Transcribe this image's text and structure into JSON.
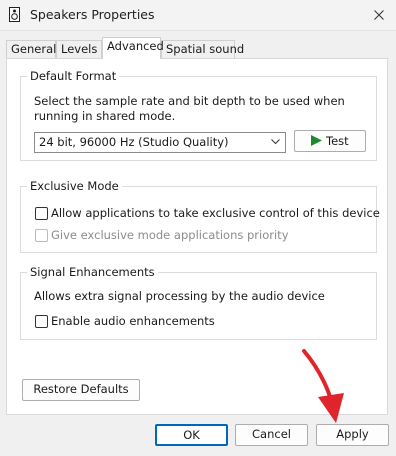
{
  "window": {
    "title": "Speakers Properties"
  },
  "tabs": [
    {
      "label": "General"
    },
    {
      "label": "Levels"
    },
    {
      "label": "Advanced"
    },
    {
      "label": "Spatial sound"
    }
  ],
  "default_format": {
    "heading": "Default Format",
    "description": "Select the sample rate and bit depth to be used when running in shared mode.",
    "selected_format": "24 bit, 96000 Hz (Studio Quality)",
    "test_label": "Test"
  },
  "exclusive_mode": {
    "heading": "Exclusive Mode",
    "allow_label": "Allow applications to take exclusive control of this device",
    "priority_label": "Give exclusive mode applications priority"
  },
  "signal_enhancements": {
    "heading": "Signal Enhancements",
    "description": "Allows extra signal processing by the audio device",
    "enable_label": "Enable audio enhancements"
  },
  "restore_label": "Restore Defaults",
  "footer": {
    "ok": "OK",
    "cancel": "Cancel",
    "apply": "Apply"
  },
  "colors": {
    "accent": "#0067c0",
    "play": "#1e8a2e",
    "annotation_arrow": "#e0242b"
  }
}
